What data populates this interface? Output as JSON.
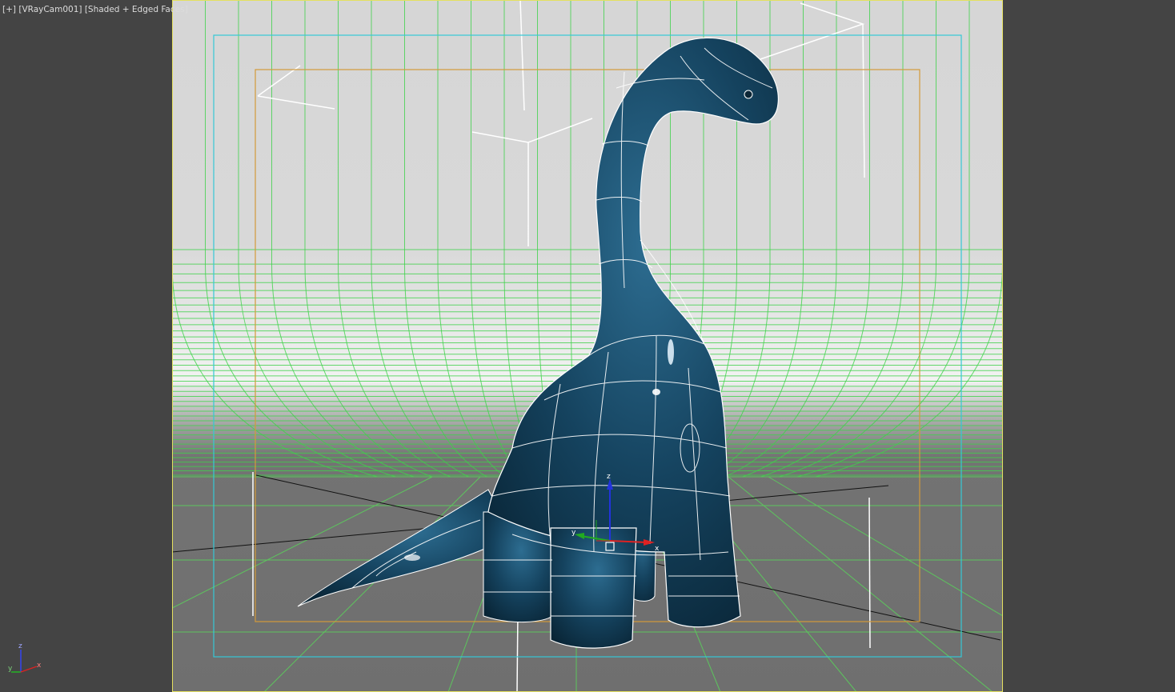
{
  "viewport": {
    "menu_label": "[+]",
    "camera_label": "[VRayCam001]",
    "shading_label": "[Shaded + Edged Faces]",
    "colors": {
      "background": "#444444",
      "frame_border": "#e4e060",
      "safe_frame_outer": "#35c8d6",
      "safe_frame_inner": "#d39a3a",
      "backdrop_wire": "#3fd24a",
      "model_shade": "#174b6a",
      "model_wire": "#ffffff",
      "gizmo_z": "#2233dd",
      "gizmo_y": "#22aa22",
      "gizmo_x": "#dd2222"
    }
  },
  "gizmo": {
    "axis_z": "z",
    "axis_y": "y",
    "axis_x": "x"
  },
  "tripod": {
    "axis_z": "z",
    "axis_y": "y",
    "axis_x": "x"
  }
}
